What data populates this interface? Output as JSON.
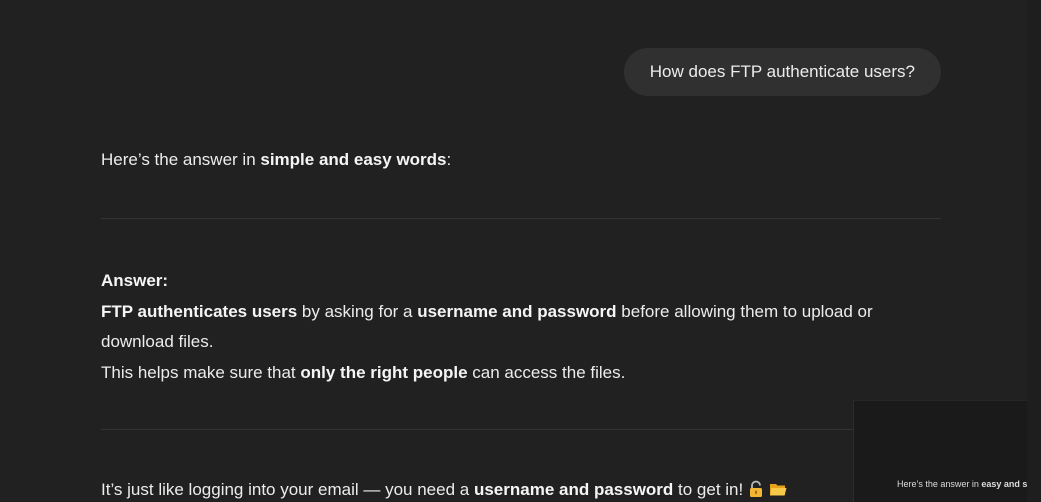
{
  "user_message": "How does FTP authenticate users?",
  "intro": {
    "prefix": "Here’s the answer in ",
    "bold": "simple and easy words",
    "suffix": ":"
  },
  "answer": {
    "heading": "Answer:",
    "line1": {
      "bold1": "FTP authenticates users",
      "text1": " by asking for a ",
      "bold2": "username and password",
      "text2": " before allowing them to upload or download files."
    },
    "line2": {
      "text1": "This helps make sure that ",
      "bold": "only the right people",
      "text2": " can access the files."
    }
  },
  "final": {
    "text1": "It’s just like logging into your email — you need a ",
    "bold": "username and password",
    "text2": " to get in!"
  },
  "icons": [
    "lock-icon",
    "folder-icon"
  ],
  "thumbnail": {
    "prefix": "Here’s the answer in ",
    "bold": "easy and simp"
  },
  "colors": {
    "background": "#212121",
    "bubble": "#303030",
    "text": "#ececec"
  }
}
